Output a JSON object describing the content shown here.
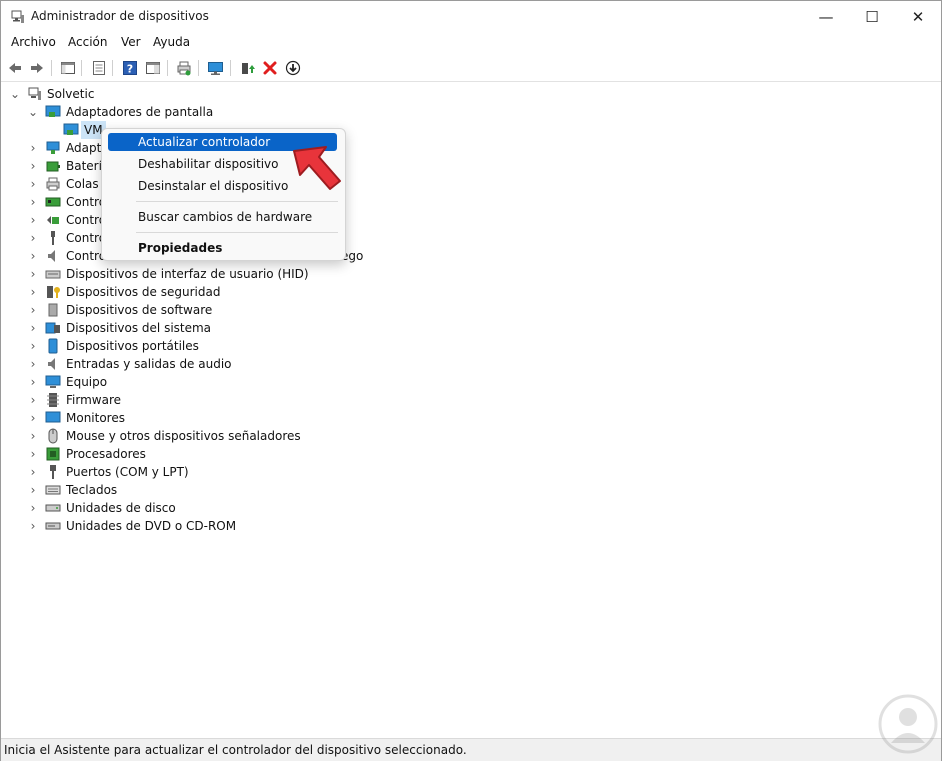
{
  "window": {
    "title": "Administrador de dispositivos"
  },
  "controls": {
    "minimize": "—",
    "maximize": "☐",
    "close": "✕"
  },
  "menu": [
    "Archivo",
    "Acción",
    "Ver",
    "Ayuda"
  ],
  "tree": {
    "root": "Solvetic",
    "expanded_category": "Adaptadores de pantalla",
    "expanded_child": "VMware SVGA 3D",
    "visible_child": "VM",
    "categories_partial": [
      "Adaptadores de red",
      "Baterías",
      "Colas de impresión",
      "Controladoras ATA/ATAPI IDE",
      "Controladoras de almacenamiento",
      "Controladoras de bus serie universal",
      "Controladoras de sonido y vídeo y dispositivos de juego"
    ],
    "categories_partial_visible": [
      "Adapt",
      "Batería",
      "Colas",
      "Contro",
      "Contro",
      "Contro",
      "Contro"
    ],
    "tail_visible": "ego",
    "categories": [
      "Dispositivos de interfaz de usuario (HID)",
      "Dispositivos de seguridad",
      "Dispositivos de software",
      "Dispositivos del sistema",
      "Dispositivos portátiles",
      "Entradas y salidas de audio",
      "Equipo",
      "Firmware",
      "Monitores",
      "Mouse y otros dispositivos señaladores",
      "Procesadores",
      "Puertos (COM y LPT)",
      "Teclados",
      "Unidades de disco",
      "Unidades de DVD o CD-ROM"
    ]
  },
  "context_menu": {
    "update": "Actualizar controlador",
    "disable": "Deshabilitar dispositivo",
    "uninstall": "Desinstalar el dispositivo",
    "scan": "Buscar cambios de hardware",
    "properties": "Propiedades"
  },
  "status": "Inicia el Asistente para actualizar el controlador del dispositivo seleccionado."
}
